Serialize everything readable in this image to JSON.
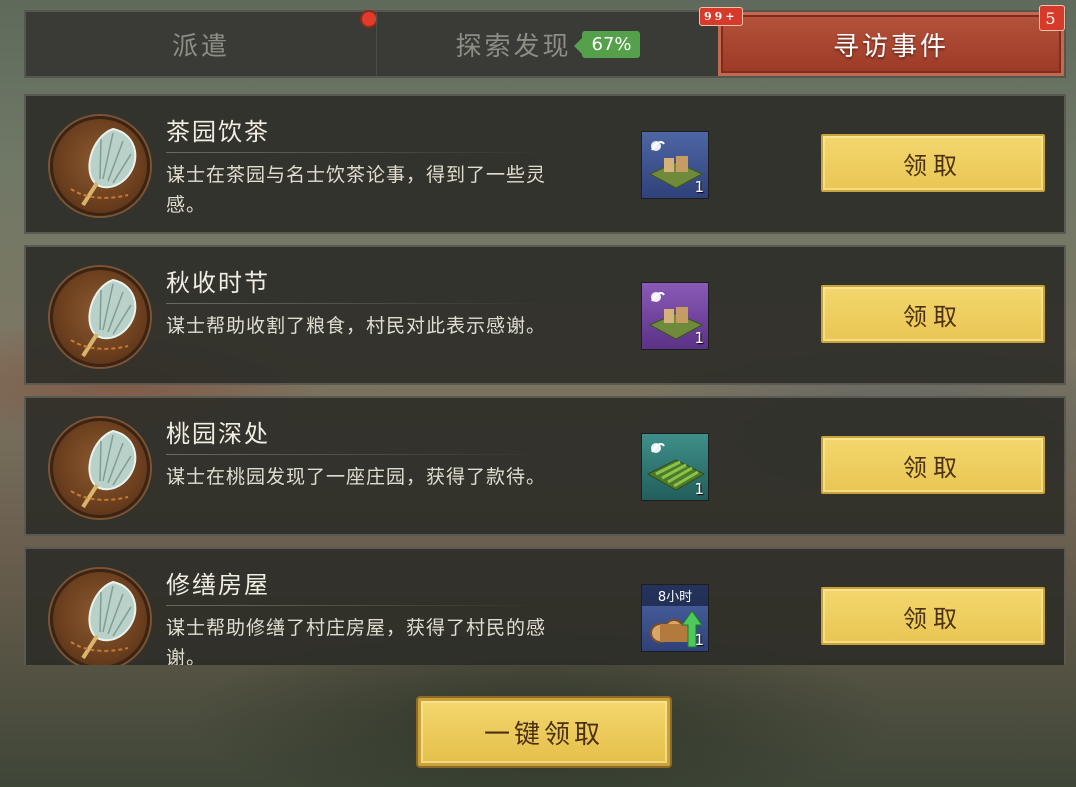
{
  "tabs": {
    "dispatch": "派遣",
    "explore": "探索发现",
    "explore_progress": "67%",
    "explore_badge": "99+",
    "visit": "寻访事件",
    "visit_badge": "5"
  },
  "events": [
    {
      "title": "茶园饮茶",
      "description": "谋士在茶园与名士饮茶论事，得到了一些灵感。",
      "reward": {
        "quantity": "1",
        "color": "blue",
        "icon": "workshop-building-icon"
      },
      "claim_label": "领取"
    },
    {
      "title": "秋收时节",
      "description": "谋士帮助收割了粮食，村民对此表示感谢。",
      "reward": {
        "quantity": "1",
        "color": "purple",
        "icon": "workshop-building-icon"
      },
      "claim_label": "领取"
    },
    {
      "title": "桃园深处",
      "description": "谋士在桃园发现了一座庄园，获得了款待。",
      "reward": {
        "quantity": "1",
        "color": "teal",
        "icon": "farmland-icon"
      },
      "claim_label": "领取"
    },
    {
      "title": "修缮房屋",
      "description": "谋士帮助修缮了村庄房屋，获得了村民的感谢。",
      "reward": {
        "quantity": "1",
        "color": "blue",
        "icon": "wood-speedup-icon",
        "time_label": "8小时"
      },
      "claim_label": "领取"
    }
  ],
  "claim_all_label": "一键领取",
  "colors": {
    "active_tab": "#a8432e",
    "claim_button": "#efcf60",
    "progress_badge": "#55a04a",
    "notification": "#d63a2a"
  }
}
